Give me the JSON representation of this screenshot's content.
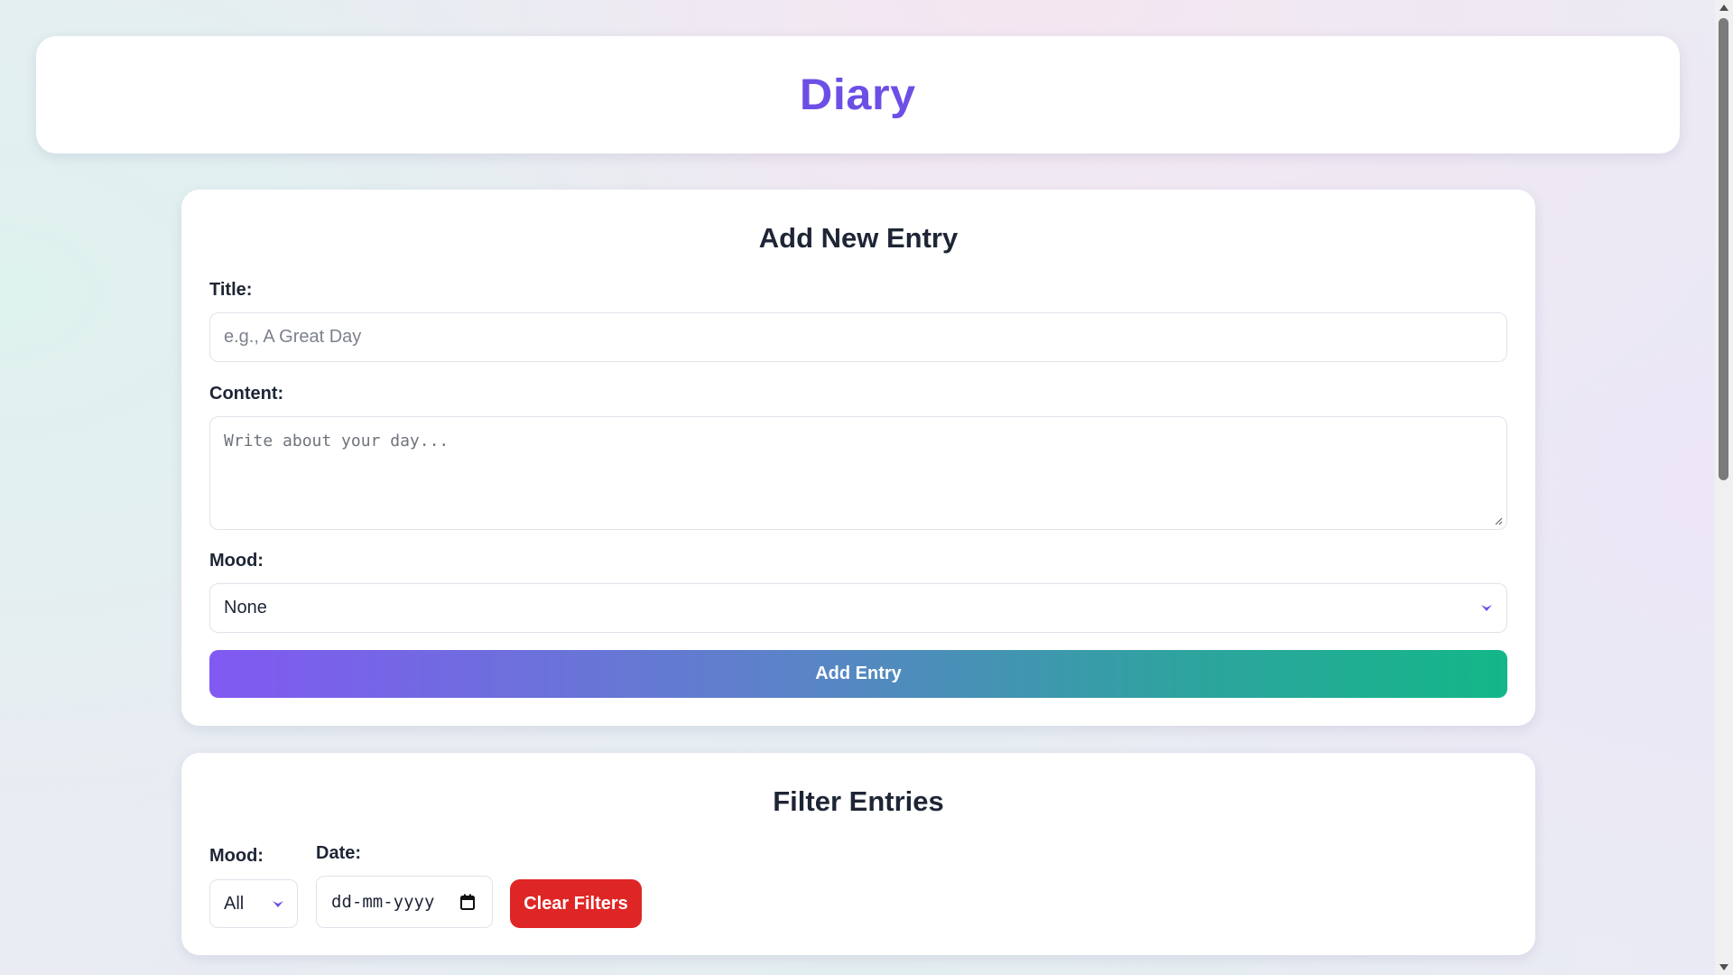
{
  "header": {
    "title": "Diary"
  },
  "add_entry": {
    "heading": "Add New Entry",
    "title_label": "Title:",
    "title_placeholder": "e.g., A Great Day",
    "content_label": "Content:",
    "content_placeholder": "Write about your day...",
    "mood_label": "Mood:",
    "mood_selected": "None",
    "submit_label": "Add Entry"
  },
  "filter": {
    "heading": "Filter Entries",
    "mood_label": "Mood:",
    "mood_selected": "All",
    "date_label": "Date:",
    "date_placeholder": "dd-mm-yyyy",
    "clear_label": "Clear Filters"
  },
  "icons": {
    "mood_dropdown": "chevron-down-icon",
    "filter_mood_dropdown": "chevron-down-icon",
    "date_picker": "calendar-icon",
    "scroll_up": "arrow-up-icon",
    "scroll_down": "arrow-down-icon"
  },
  "colors": {
    "accent": "#6d4fe6",
    "button_gradient_start": "#8159f2",
    "button_gradient_end": "#13b788",
    "danger": "#df2626",
    "text": "#1e2535"
  }
}
